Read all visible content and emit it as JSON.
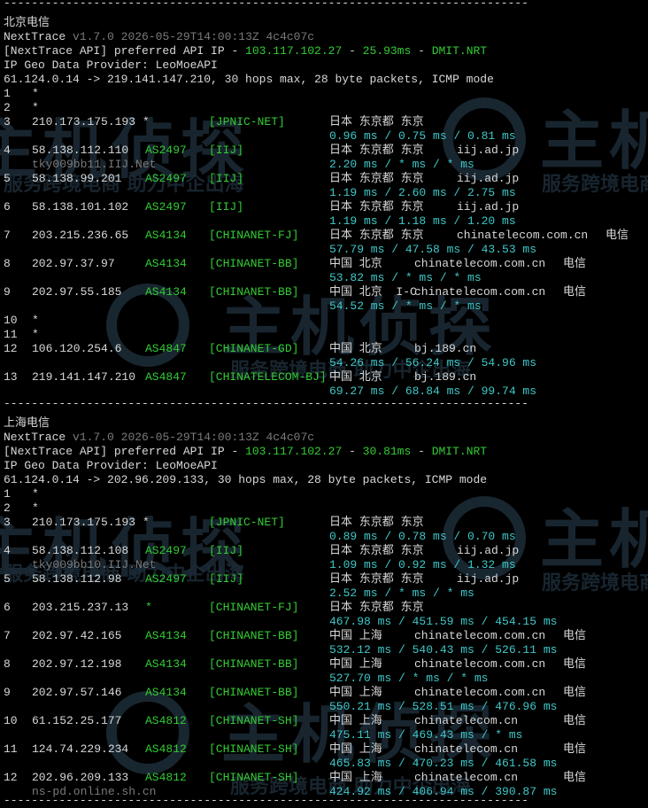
{
  "separator": "----------------------------------------------------------------------------",
  "sections": [
    {
      "title": "北京电信",
      "tool": "NextTrace",
      "version": "v1.7.0 2026-05-29T14:00:13Z 4c4c07c",
      "api_prefix": "[NextTrace API] preferred API IP - ",
      "api_ip": "103.117.102.27",
      "api_latency": "25.93ms",
      "api_node": "DMIT.NRT",
      "geo_provider": "IP Geo Data Provider: LeoMoeAPI",
      "route": "61.124.0.14 -> 219.141.147.210, 30 hops max, 28 byte packets, ICMP mode",
      "hops": [
        {
          "n": "1",
          "ip": "*",
          "asn": "",
          "org": "",
          "geo": "",
          "host": "",
          "isp": "",
          "rtt": "",
          "ptr": ""
        },
        {
          "n": "2",
          "ip": "*",
          "asn": "",
          "org": "",
          "geo": "",
          "host": "",
          "isp": "",
          "rtt": "",
          "ptr": ""
        },
        {
          "n": "3",
          "ip": "210.173.175.193 *",
          "asn": "",
          "org": "[JPNIC-NET]",
          "geo": "日本 东京都 东京",
          "host": "",
          "isp": "",
          "rtt": "0.96 ms / 0.75 ms / 0.81 ms",
          "ptr": ""
        },
        {
          "n": "4",
          "ip": "58.138.112.110",
          "asn": "AS2497",
          "org": "[IIJ]",
          "geo": "日本 东京都 东京",
          "host": "iij.ad.jp",
          "isp": "",
          "rtt": "2.20 ms / * ms / * ms",
          "ptr": "tky009bb11.IIJ.Net"
        },
        {
          "n": "5",
          "ip": "58.138.99.201",
          "asn": "AS2497",
          "org": "[IIJ]",
          "geo": "日本 东京都 东京",
          "host": "iij.ad.jp",
          "isp": "",
          "rtt": "1.19 ms / 2.60 ms / 2.75 ms",
          "ptr": ""
        },
        {
          "n": "6",
          "ip": "58.138.101.102",
          "asn": "AS2497",
          "org": "[IIJ]",
          "geo": "日本 东京都 东京",
          "host": "iij.ad.jp",
          "isp": "",
          "rtt": "1.19 ms / 1.18 ms / 1.20 ms",
          "ptr": ""
        },
        {
          "n": "7",
          "ip": "203.215.236.65",
          "asn": "AS4134",
          "org": "[CHINANET-FJ]",
          "geo": "日本 东京都 东京",
          "host": "chinatelecom.com.cn",
          "isp": "电信",
          "rtt": "57.79 ms / 47.58 ms / 43.53 ms",
          "ptr": ""
        },
        {
          "n": "8",
          "ip": "202.97.37.97",
          "asn": "AS4134",
          "org": "[CHINANET-BB]",
          "geo": "中国 北京",
          "host": "chinatelecom.com.cn",
          "isp": "电信",
          "rtt": "53.82 ms / * ms / * ms",
          "ptr": ""
        },
        {
          "n": "9",
          "ip": "202.97.55.185",
          "asn": "AS4134",
          "org": "[CHINANET-BB]",
          "geo": "中国 北京  I-C",
          "host": "chinatelecom.com.cn",
          "isp": "电信",
          "rtt": "54.52 ms / * ms / * ms",
          "ptr": ""
        },
        {
          "n": "10",
          "ip": "*",
          "asn": "",
          "org": "",
          "geo": "",
          "host": "",
          "isp": "",
          "rtt": "",
          "ptr": ""
        },
        {
          "n": "11",
          "ip": "*",
          "asn": "",
          "org": "",
          "geo": "",
          "host": "",
          "isp": "",
          "rtt": "",
          "ptr": ""
        },
        {
          "n": "12",
          "ip": "106.120.254.6",
          "asn": "AS4847",
          "org": "[CHINANET-GD]",
          "geo": "中国 北京",
          "host": "bj.189.cn",
          "isp": "",
          "rtt": "54.26 ms / 56.24 ms / 54.96 ms",
          "ptr": ""
        },
        {
          "n": "13",
          "ip": "219.141.147.210",
          "asn": "AS4847",
          "org": "[CHINATELECOM-BJ]",
          "geo": "中国 北京",
          "host": "bj.189.cn",
          "isp": "",
          "rtt": "69.27 ms / 68.84 ms / 99.74 ms",
          "ptr": ""
        }
      ]
    },
    {
      "title": "上海电信",
      "tool": "NextTrace",
      "version": "v1.7.0 2026-05-29T14:00:13Z 4c4c07c",
      "api_prefix": "[NextTrace API] preferred API IP - ",
      "api_ip": "103.117.102.27",
      "api_latency": "30.81ms",
      "api_node": "DMIT.NRT",
      "geo_provider": "IP Geo Data Provider: LeoMoeAPI",
      "route": "61.124.0.14 -> 202.96.209.133, 30 hops max, 28 byte packets, ICMP mode",
      "hops": [
        {
          "n": "1",
          "ip": "*",
          "asn": "",
          "org": "",
          "geo": "",
          "host": "",
          "isp": "",
          "rtt": "",
          "ptr": ""
        },
        {
          "n": "2",
          "ip": "*",
          "asn": "",
          "org": "",
          "geo": "",
          "host": "",
          "isp": "",
          "rtt": "",
          "ptr": ""
        },
        {
          "n": "3",
          "ip": "210.173.175.193 *",
          "asn": "",
          "org": "[JPNIC-NET]",
          "geo": "日本 东京都 东京",
          "host": "",
          "isp": "",
          "rtt": "0.89 ms / 0.78 ms / 0.70 ms",
          "ptr": ""
        },
        {
          "n": "4",
          "ip": "58.138.112.108",
          "asn": "AS2497",
          "org": "[IIJ]",
          "geo": "日本 东京都 东京",
          "host": "iij.ad.jp",
          "isp": "",
          "rtt": "1.09 ms / 0.92 ms / 1.32 ms",
          "ptr": "tky009bb10.IIJ.Net"
        },
        {
          "n": "5",
          "ip": "58.138.112.98",
          "asn": "AS2497",
          "org": "[IIJ]",
          "geo": "日本 东京都 东京",
          "host": "iij.ad.jp",
          "isp": "",
          "rtt": "2.52 ms / * ms / * ms",
          "ptr": ""
        },
        {
          "n": "6",
          "ip": "203.215.237.13",
          "asn": "*",
          "org": "[CHINANET-FJ]",
          "geo": "日本 东京都 东京",
          "host": "",
          "isp": "",
          "rtt": "467.98 ms / 451.59 ms / 454.15 ms",
          "ptr": ""
        },
        {
          "n": "7",
          "ip": "202.97.42.165",
          "asn": "AS4134",
          "org": "[CHINANET-BB]",
          "geo": "中国 上海",
          "host": "chinatelecom.com.cn",
          "isp": "电信",
          "rtt": "532.12 ms / 540.43 ms / 526.11 ms",
          "ptr": ""
        },
        {
          "n": "8",
          "ip": "202.97.12.198",
          "asn": "AS4134",
          "org": "[CHINANET-BB]",
          "geo": "中国 上海",
          "host": "chinatelecom.com.cn",
          "isp": "电信",
          "rtt": "527.70 ms / * ms / * ms",
          "ptr": ""
        },
        {
          "n": "9",
          "ip": "202.97.57.146",
          "asn": "AS4134",
          "org": "[CHINANET-BB]",
          "geo": "中国 上海",
          "host": "chinatelecom.com.cn",
          "isp": "电信",
          "rtt": "550.21 ms / 528.51 ms / 476.96 ms",
          "ptr": ""
        },
        {
          "n": "10",
          "ip": "61.152.25.177",
          "asn": "AS4812",
          "org": "[CHINANET-SH]",
          "geo": "中国 上海",
          "host": "chinatelecom.cn",
          "isp": "电信",
          "rtt": "475.11 ms / 469.43 ms / * ms",
          "ptr": ""
        },
        {
          "n": "11",
          "ip": "124.74.229.234",
          "asn": "AS4812",
          "org": "[CHINANET-SH]",
          "geo": "中国 上海",
          "host": "chinatelecom.cn",
          "isp": "电信",
          "rtt": "465.83 ms / 470.23 ms / 461.58 ms",
          "ptr": ""
        },
        {
          "n": "12",
          "ip": "202.96.209.133",
          "asn": "AS4812",
          "org": "[CHINANET-SH]",
          "geo": "中国 上海",
          "host": "chinatelecom.cn",
          "isp": "电信",
          "rtt": "424.92 ms / 406.94 ms / 390.87 ms",
          "ptr": "ns-pd.online.sh.cn"
        }
      ]
    }
  ],
  "watermark": {
    "brand": "主机侦探",
    "slogan": "服务跨境电商 助力中企出海"
  },
  "colors": {
    "background": "#000000",
    "text": "#c8c8c8",
    "green": "#33cc33",
    "cyan": "#3fc8c8",
    "dim": "#7a7a7a"
  }
}
